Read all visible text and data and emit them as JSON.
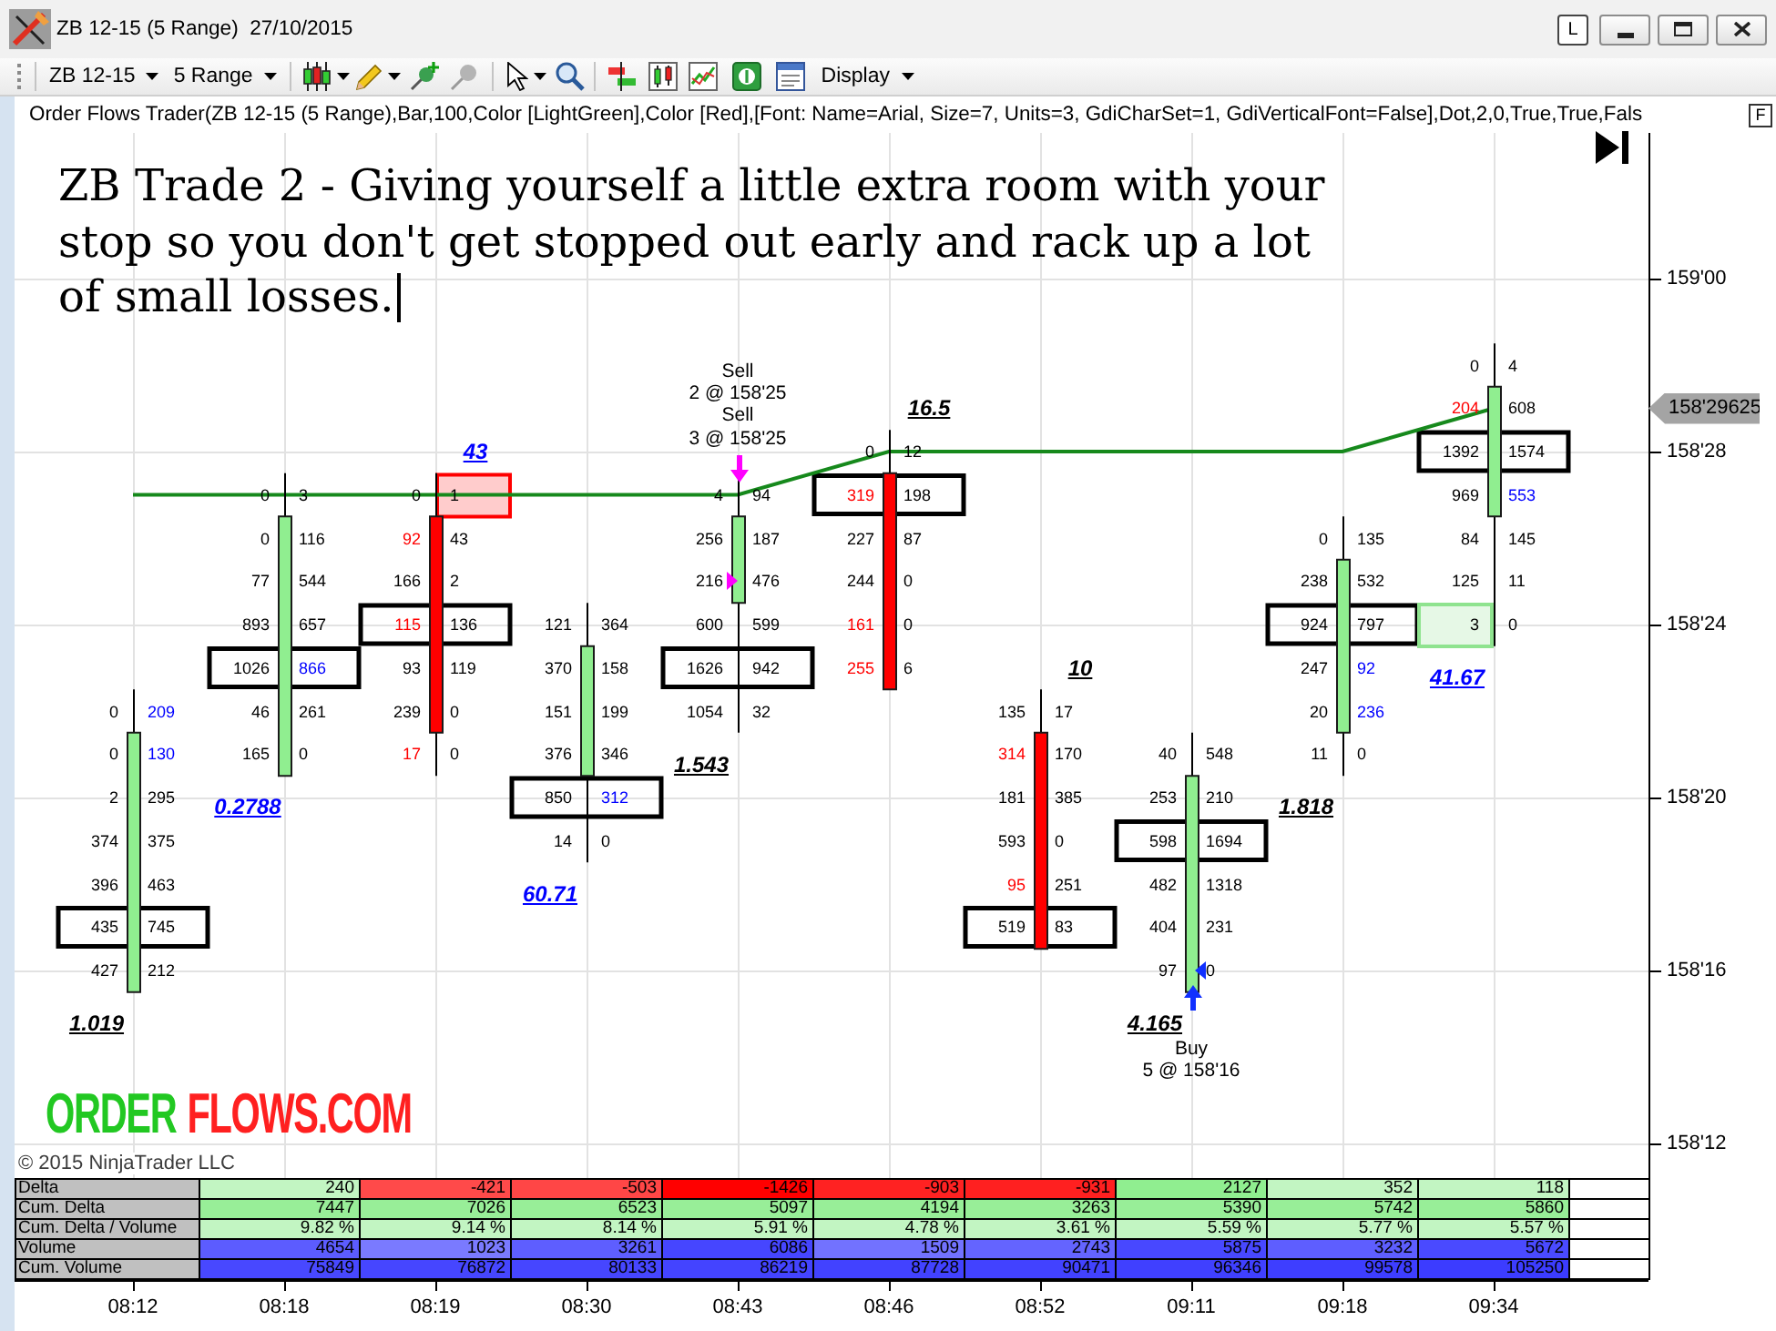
{
  "window": {
    "title": "ZB 12-15 (5 Range)  27/10/2015",
    "caption_button": "L"
  },
  "toolbar": {
    "instrument": "ZB 12-15",
    "period": "5 Range",
    "display": "Display"
  },
  "chart": {
    "indicator_label": "Order Flows Trader(ZB 12-15 (5 Range),Bar,100,Color [LightGreen],Color [Red],[Font: Name=Arial, Size=7, Units=3, GdiCharSet=1, GdiVerticalFont=False],Dot,2,0,True,True,Fals",
    "panel_button": "F",
    "annotation": "ZB Trade 2 - Giving yourself a little extra room with your stop so you don't get stopped out early and rack up a lot of small losses.",
    "logo": [
      {
        "text": "ORDER",
        "color": "#22c822"
      },
      {
        "text": "FLOWS.COM",
        "color": "#ff2020"
      }
    ],
    "price_axis": [
      "159'00",
      "158'28",
      "158'24",
      "158'20",
      "158'16",
      "158'12"
    ],
    "last_price": "158'29625",
    "time_axis": [
      "08:12",
      "08:18",
      "08:19",
      "08:30",
      "08:43",
      "08:46",
      "08:52",
      "09:11",
      "09:18",
      "09:34"
    ],
    "bars": [
      {
        "kind": "up",
        "ratio": {
          "text": "1.019",
          "color": "#000000"
        },
        "rows": [
          null,
          null,
          null,
          null,
          null,
          null,
          null,
          null,
          null,
          null,
          {
            "bid": "0",
            "ask": "209",
            "bid_imbalance": false,
            "ask_imbalance": true,
            "boxed": false,
            "bid_highlighted": false,
            "ask_highlighted": false,
            "body": false,
            "fill": false
          },
          {
            "bid": "0",
            "ask": "130",
            "bid_imbalance": false,
            "ask_imbalance": true,
            "boxed": false,
            "bid_highlighted": false,
            "ask_highlighted": false,
            "body": true,
            "fill": false
          },
          {
            "bid": "2",
            "ask": "295",
            "bid_imbalance": false,
            "ask_imbalance": false,
            "boxed": false,
            "bid_highlighted": false,
            "ask_highlighted": false,
            "body": true,
            "fill": false
          },
          {
            "bid": "374",
            "ask": "375",
            "bid_imbalance": false,
            "ask_imbalance": false,
            "boxed": false,
            "bid_highlighted": false,
            "ask_highlighted": false,
            "body": true,
            "fill": false
          },
          {
            "bid": "396",
            "ask": "463",
            "bid_imbalance": false,
            "ask_imbalance": false,
            "boxed": false,
            "bid_highlighted": false,
            "ask_highlighted": false,
            "body": true,
            "fill": false
          },
          {
            "bid": "435",
            "ask": "745",
            "bid_imbalance": false,
            "ask_imbalance": false,
            "boxed": true,
            "bid_highlighted": false,
            "ask_highlighted": false,
            "body": true,
            "fill": false
          },
          {
            "bid": "427",
            "ask": "212",
            "bid_imbalance": false,
            "ask_imbalance": false,
            "boxed": false,
            "bid_highlighted": false,
            "ask_highlighted": false,
            "body": true,
            "fill": false
          }
        ]
      },
      {
        "kind": "up",
        "ratio": {
          "text": "0.2788",
          "color": "#0000ff"
        },
        "rows": [
          null,
          null,
          null,
          null,
          null,
          {
            "bid": "0",
            "ask": "3",
            "bid_imbalance": false,
            "ask_imbalance": false,
            "boxed": false,
            "bid_highlighted": false,
            "ask_highlighted": false,
            "body": false,
            "fill": false
          },
          {
            "bid": "0",
            "ask": "116",
            "bid_imbalance": false,
            "ask_imbalance": false,
            "boxed": false,
            "bid_highlighted": false,
            "ask_highlighted": false,
            "body": true,
            "fill": false
          },
          {
            "bid": "77",
            "ask": "544",
            "bid_imbalance": false,
            "ask_imbalance": false,
            "boxed": false,
            "bid_highlighted": false,
            "ask_highlighted": false,
            "body": true,
            "fill": false
          },
          {
            "bid": "893",
            "ask": "657",
            "bid_imbalance": false,
            "ask_imbalance": false,
            "boxed": false,
            "bid_highlighted": false,
            "ask_highlighted": false,
            "body": true,
            "fill": false
          },
          {
            "bid": "1026",
            "ask": "866",
            "bid_imbalance": false,
            "ask_imbalance": true,
            "boxed": true,
            "bid_highlighted": false,
            "ask_highlighted": false,
            "body": true,
            "fill": false
          },
          {
            "bid": "46",
            "ask": "261",
            "bid_imbalance": false,
            "ask_imbalance": false,
            "boxed": false,
            "bid_highlighted": false,
            "ask_highlighted": false,
            "body": true,
            "fill": false
          },
          {
            "bid": "165",
            "ask": "0",
            "bid_imbalance": false,
            "ask_imbalance": false,
            "boxed": false,
            "bid_highlighted": false,
            "ask_highlighted": false,
            "body": true,
            "fill": false
          }
        ]
      },
      {
        "kind": "down",
        "ratio": {
          "text": "43",
          "color": "#0000ff"
        },
        "rows": [
          null,
          null,
          null,
          null,
          null,
          {
            "bid": "0",
            "ask": "1",
            "bid_imbalance": false,
            "ask_imbalance": false,
            "boxed": false,
            "bid_highlighted": false,
            "ask_highlighted": true,
            "body": false,
            "fill": false
          },
          {
            "bid": "92",
            "ask": "43",
            "bid_imbalance": true,
            "ask_imbalance": false,
            "boxed": false,
            "bid_highlighted": false,
            "ask_highlighted": false,
            "body": true,
            "fill": false
          },
          {
            "bid": "166",
            "ask": "2",
            "bid_imbalance": false,
            "ask_imbalance": false,
            "boxed": false,
            "bid_highlighted": false,
            "ask_highlighted": false,
            "body": true,
            "fill": false
          },
          {
            "bid": "115",
            "ask": "136",
            "bid_imbalance": true,
            "ask_imbalance": false,
            "boxed": true,
            "bid_highlighted": false,
            "ask_highlighted": false,
            "body": true,
            "fill": false
          },
          {
            "bid": "93",
            "ask": "119",
            "bid_imbalance": false,
            "ask_imbalance": false,
            "boxed": false,
            "bid_highlighted": false,
            "ask_highlighted": false,
            "body": true,
            "fill": false
          },
          {
            "bid": "239",
            "ask": "0",
            "bid_imbalance": false,
            "ask_imbalance": false,
            "boxed": false,
            "bid_highlighted": false,
            "ask_highlighted": false,
            "body": true,
            "fill": false
          },
          {
            "bid": "17",
            "ask": "0",
            "bid_imbalance": true,
            "ask_imbalance": false,
            "boxed": false,
            "bid_highlighted": false,
            "ask_highlighted": false,
            "body": false,
            "fill": false
          }
        ]
      },
      {
        "kind": "up",
        "ratio": {
          "text": "60.71",
          "color": "#0000ff"
        },
        "rows": [
          null,
          null,
          null,
          null,
          null,
          null,
          null,
          null,
          {
            "bid": "121",
            "ask": "364",
            "bid_imbalance": false,
            "ask_imbalance": false,
            "boxed": false,
            "bid_highlighted": false,
            "ask_highlighted": false,
            "body": false,
            "fill": false
          },
          {
            "bid": "370",
            "ask": "158",
            "bid_imbalance": false,
            "ask_imbalance": false,
            "boxed": false,
            "bid_highlighted": false,
            "ask_highlighted": false,
            "body": true,
            "fill": false
          },
          {
            "bid": "151",
            "ask": "199",
            "bid_imbalance": false,
            "ask_imbalance": false,
            "boxed": false,
            "bid_highlighted": false,
            "ask_highlighted": false,
            "body": true,
            "fill": false
          },
          {
            "bid": "376",
            "ask": "346",
            "bid_imbalance": false,
            "ask_imbalance": false,
            "boxed": false,
            "bid_highlighted": false,
            "ask_highlighted": false,
            "body": true,
            "fill": false
          },
          {
            "bid": "850",
            "ask": "312",
            "bid_imbalance": false,
            "ask_imbalance": true,
            "boxed": true,
            "bid_highlighted": false,
            "ask_highlighted": false,
            "body": false,
            "fill": false
          },
          {
            "bid": "14",
            "ask": "0",
            "bid_imbalance": false,
            "ask_imbalance": false,
            "boxed": false,
            "bid_highlighted": false,
            "ask_highlighted": false,
            "body": false,
            "fill": false
          }
        ]
      },
      {
        "kind": "up",
        "ratio": {
          "text": "1.543",
          "color": "#000000"
        },
        "order": {
          "kind": "sell",
          "lines": [
            "Sell",
            "2 @ 158'25",
            "Sell",
            "3 @ 158'25"
          ]
        },
        "rows": [
          null,
          null,
          null,
          null,
          null,
          {
            "bid": "4",
            "ask": "94",
            "bid_imbalance": false,
            "ask_imbalance": false,
            "boxed": false,
            "bid_highlighted": false,
            "ask_highlighted": false,
            "body": false,
            "fill": false
          },
          {
            "bid": "256",
            "ask": "187",
            "bid_imbalance": false,
            "ask_imbalance": false,
            "boxed": false,
            "bid_highlighted": false,
            "ask_highlighted": false,
            "body": true,
            "fill": false
          },
          {
            "bid": "216",
            "ask": "476",
            "bid_imbalance": false,
            "ask_imbalance": false,
            "boxed": false,
            "bid_highlighted": false,
            "ask_highlighted": false,
            "body": true,
            "fill": true
          },
          {
            "bid": "600",
            "ask": "599",
            "bid_imbalance": false,
            "ask_imbalance": false,
            "boxed": false,
            "bid_highlighted": false,
            "ask_highlighted": false,
            "body": false,
            "fill": false
          },
          {
            "bid": "1626",
            "ask": "942",
            "bid_imbalance": false,
            "ask_imbalance": false,
            "boxed": true,
            "bid_highlighted": false,
            "ask_highlighted": false,
            "body": false,
            "fill": false
          },
          {
            "bid": "1054",
            "ask": "32",
            "bid_imbalance": false,
            "ask_imbalance": false,
            "boxed": false,
            "bid_highlighted": false,
            "ask_highlighted": false,
            "body": false,
            "fill": false
          }
        ]
      },
      {
        "kind": "down",
        "ratio": {
          "text": "16.5",
          "color": "#000000"
        },
        "rows": [
          null,
          null,
          null,
          null,
          {
            "bid": "0",
            "ask": "12",
            "bid_imbalance": false,
            "ask_imbalance": false,
            "boxed": false,
            "bid_highlighted": false,
            "ask_highlighted": false,
            "body": false,
            "fill": false
          },
          {
            "bid": "319",
            "ask": "198",
            "bid_imbalance": true,
            "ask_imbalance": false,
            "boxed": true,
            "bid_highlighted": false,
            "ask_highlighted": false,
            "body": true,
            "fill": false
          },
          {
            "bid": "227",
            "ask": "87",
            "bid_imbalance": false,
            "ask_imbalance": false,
            "boxed": false,
            "bid_highlighted": false,
            "ask_highlighted": false,
            "body": true,
            "fill": false
          },
          {
            "bid": "244",
            "ask": "0",
            "bid_imbalance": false,
            "ask_imbalance": false,
            "boxed": false,
            "bid_highlighted": false,
            "ask_highlighted": false,
            "body": true,
            "fill": false
          },
          {
            "bid": "161",
            "ask": "0",
            "bid_imbalance": true,
            "ask_imbalance": false,
            "boxed": false,
            "bid_highlighted": false,
            "ask_highlighted": false,
            "body": true,
            "fill": false
          },
          {
            "bid": "255",
            "ask": "6",
            "bid_imbalance": true,
            "ask_imbalance": false,
            "boxed": false,
            "bid_highlighted": false,
            "ask_highlighted": false,
            "body": true,
            "fill": false
          }
        ]
      },
      {
        "kind": "down",
        "ratio": {
          "text": "10",
          "color": "#000000"
        },
        "rows": [
          null,
          null,
          null,
          null,
          null,
          null,
          null,
          null,
          null,
          null,
          {
            "bid": "135",
            "ask": "17",
            "bid_imbalance": false,
            "ask_imbalance": false,
            "boxed": false,
            "bid_highlighted": false,
            "ask_highlighted": false,
            "body": false,
            "fill": false
          },
          {
            "bid": "314",
            "ask": "170",
            "bid_imbalance": true,
            "ask_imbalance": false,
            "boxed": false,
            "bid_highlighted": false,
            "ask_highlighted": false,
            "body": true,
            "fill": false
          },
          {
            "bid": "181",
            "ask": "385",
            "bid_imbalance": false,
            "ask_imbalance": false,
            "boxed": false,
            "bid_highlighted": false,
            "ask_highlighted": false,
            "body": true,
            "fill": false
          },
          {
            "bid": "593",
            "ask": "0",
            "bid_imbalance": false,
            "ask_imbalance": false,
            "boxed": false,
            "bid_highlighted": false,
            "ask_highlighted": false,
            "body": true,
            "fill": false
          },
          {
            "bid": "95",
            "ask": "251",
            "bid_imbalance": true,
            "ask_imbalance": false,
            "boxed": false,
            "bid_highlighted": false,
            "ask_highlighted": false,
            "body": true,
            "fill": false
          },
          {
            "bid": "519",
            "ask": "83",
            "bid_imbalance": false,
            "ask_imbalance": false,
            "boxed": true,
            "bid_highlighted": false,
            "ask_highlighted": false,
            "body": true,
            "fill": false
          }
        ]
      },
      {
        "kind": "up",
        "ratio": {
          "text": "4.165",
          "color": "#000000"
        },
        "order": {
          "kind": "buy",
          "lines": [
            "Buy",
            "5 @ 158'16"
          ]
        },
        "rows": [
          null,
          null,
          null,
          null,
          null,
          null,
          null,
          null,
          null,
          null,
          null,
          {
            "bid": "40",
            "ask": "548",
            "bid_imbalance": false,
            "ask_imbalance": false,
            "boxed": false,
            "bid_highlighted": false,
            "ask_highlighted": false,
            "body": false,
            "fill": false
          },
          {
            "bid": "253",
            "ask": "210",
            "bid_imbalance": false,
            "ask_imbalance": false,
            "boxed": false,
            "bid_highlighted": false,
            "ask_highlighted": false,
            "body": true,
            "fill": false
          },
          {
            "bid": "598",
            "ask": "1694",
            "bid_imbalance": false,
            "ask_imbalance": false,
            "boxed": true,
            "bid_highlighted": false,
            "ask_highlighted": false,
            "body": true,
            "fill": false
          },
          {
            "bid": "482",
            "ask": "1318",
            "bid_imbalance": false,
            "ask_imbalance": false,
            "boxed": false,
            "bid_highlighted": false,
            "ask_highlighted": false,
            "body": true,
            "fill": false
          },
          {
            "bid": "404",
            "ask": "231",
            "bid_imbalance": false,
            "ask_imbalance": false,
            "boxed": false,
            "bid_highlighted": false,
            "ask_highlighted": false,
            "body": true,
            "fill": false
          },
          {
            "bid": "97",
            "ask": "0",
            "bid_imbalance": false,
            "ask_imbalance": false,
            "boxed": false,
            "bid_highlighted": false,
            "ask_highlighted": false,
            "body": true,
            "fill": true
          }
        ]
      },
      {
        "kind": "up",
        "ratio": {
          "text": "1.818",
          "color": "#000000"
        },
        "rows": [
          null,
          null,
          null,
          null,
          null,
          null,
          {
            "bid": "0",
            "ask": "135",
            "bid_imbalance": false,
            "ask_imbalance": false,
            "boxed": false,
            "bid_highlighted": false,
            "ask_highlighted": false,
            "body": false,
            "fill": false
          },
          {
            "bid": "238",
            "ask": "532",
            "bid_imbalance": false,
            "ask_imbalance": false,
            "boxed": false,
            "bid_highlighted": false,
            "ask_highlighted": false,
            "body": true,
            "fill": false
          },
          {
            "bid": "924",
            "ask": "797",
            "bid_imbalance": false,
            "ask_imbalance": false,
            "boxed": true,
            "bid_highlighted": false,
            "ask_highlighted": false,
            "body": true,
            "fill": false
          },
          {
            "bid": "247",
            "ask": "92",
            "bid_imbalance": false,
            "ask_imbalance": true,
            "boxed": false,
            "bid_highlighted": false,
            "ask_highlighted": false,
            "body": true,
            "fill": false
          },
          {
            "bid": "20",
            "ask": "236",
            "bid_imbalance": false,
            "ask_imbalance": true,
            "boxed": false,
            "bid_highlighted": false,
            "ask_highlighted": false,
            "body": true,
            "fill": false
          },
          {
            "bid": "11",
            "ask": "0",
            "bid_imbalance": false,
            "ask_imbalance": false,
            "boxed": false,
            "bid_highlighted": false,
            "ask_highlighted": false,
            "body": false,
            "fill": false
          }
        ]
      },
      {
        "kind": "up",
        "ratio": {
          "text": "41.67",
          "color": "#0000ff"
        },
        "rows": [
          null,
          null,
          {
            "bid": "0",
            "ask": "4",
            "bid_imbalance": false,
            "ask_imbalance": false,
            "boxed": false,
            "bid_highlighted": false,
            "ask_highlighted": false,
            "body": false,
            "fill": false
          },
          {
            "bid": "204",
            "ask": "608",
            "bid_imbalance": true,
            "ask_imbalance": false,
            "boxed": false,
            "bid_highlighted": false,
            "ask_highlighted": false,
            "body": true,
            "fill": false
          },
          {
            "bid": "1392",
            "ask": "1574",
            "bid_imbalance": false,
            "ask_imbalance": false,
            "boxed": true,
            "bid_highlighted": false,
            "ask_highlighted": false,
            "body": true,
            "fill": false
          },
          {
            "bid": "969",
            "ask": "553",
            "bid_imbalance": false,
            "ask_imbalance": true,
            "boxed": false,
            "bid_highlighted": false,
            "ask_highlighted": false,
            "body": true,
            "fill": false
          },
          {
            "bid": "84",
            "ask": "145",
            "bid_imbalance": false,
            "ask_imbalance": false,
            "boxed": false,
            "bid_highlighted": false,
            "ask_highlighted": false,
            "body": false,
            "fill": false
          },
          {
            "bid": "125",
            "ask": "11",
            "bid_imbalance": false,
            "ask_imbalance": false,
            "boxed": false,
            "bid_highlighted": false,
            "ask_highlighted": false,
            "body": false,
            "fill": false
          },
          {
            "bid": "3",
            "ask": "0",
            "bid_imbalance": false,
            "ask_imbalance": false,
            "boxed": false,
            "bid_highlighted": true,
            "ask_highlighted": false,
            "body": false,
            "fill": false
          }
        ]
      }
    ]
  },
  "stats_table": {
    "rows": [
      {
        "label": "Delta",
        "cells": [
          {
            "text": "240",
            "color": "#c2f5c2"
          },
          {
            "text": "-421",
            "color": "#ff4a4a"
          },
          {
            "text": "-503",
            "color": "#ff4646"
          },
          {
            "text": "-1426",
            "color": "#ff0000"
          },
          {
            "text": "-903",
            "color": "#ff2222"
          },
          {
            "text": "-931",
            "color": "#ff2020"
          },
          {
            "text": "2127",
            "color": "#90ee90"
          },
          {
            "text": "352",
            "color": "#c2f5c2"
          },
          {
            "text": "118",
            "color": "#c2f5c2"
          }
        ]
      },
      {
        "label": "Cum. Delta",
        "cells": [
          {
            "text": "7447",
            "color": "#98ee98"
          },
          {
            "text": "7026",
            "color": "#98ee98"
          },
          {
            "text": "6523",
            "color": "#98ee98"
          },
          {
            "text": "5097",
            "color": "#98ee98"
          },
          {
            "text": "4194",
            "color": "#98ee98"
          },
          {
            "text": "3263",
            "color": "#98ee98"
          },
          {
            "text": "5390",
            "color": "#98ee98"
          },
          {
            "text": "5742",
            "color": "#98ee98"
          },
          {
            "text": "5860",
            "color": "#98ee98"
          }
        ]
      },
      {
        "label": "Cum. Delta / Volume",
        "cells": [
          {
            "text": "9.82 %",
            "color": "#c2f5c2"
          },
          {
            "text": "9.14 %",
            "color": "#c2f5c2"
          },
          {
            "text": "8.14 %",
            "color": "#c2f5c2"
          },
          {
            "text": "5.91 %",
            "color": "#c2f5c2"
          },
          {
            "text": "4.78 %",
            "color": "#c2f5c2"
          },
          {
            "text": "3.61 %",
            "color": "#c2f5c2"
          },
          {
            "text": "5.59 %",
            "color": "#c2f5c2"
          },
          {
            "text": "5.77 %",
            "color": "#c2f5c2"
          },
          {
            "text": "5.57 %",
            "color": "#c2f5c2"
          }
        ]
      },
      {
        "label": "Volume",
        "cells": [
          {
            "text": "4654",
            "color": "#5c5cff"
          },
          {
            "text": "1023",
            "color": "#7a7aff"
          },
          {
            "text": "3261",
            "color": "#5e5eff"
          },
          {
            "text": "6086",
            "color": "#4646ff"
          },
          {
            "text": "1509",
            "color": "#7272ff"
          },
          {
            "text": "2743",
            "color": "#6464ff"
          },
          {
            "text": "5875",
            "color": "#4848ff"
          },
          {
            "text": "3232",
            "color": "#5e5eff"
          },
          {
            "text": "5672",
            "color": "#4a4aff"
          }
        ]
      },
      {
        "label": "Cum. Volume",
        "cells": [
          {
            "text": "75849",
            "color": "#4848ff"
          },
          {
            "text": "76872",
            "color": "#4646ff"
          },
          {
            "text": "80133",
            "color": "#4646ff"
          },
          {
            "text": "86219",
            "color": "#4444ff"
          },
          {
            "text": "87728",
            "color": "#4242ff"
          },
          {
            "text": "90471",
            "color": "#4242ff"
          },
          {
            "text": "96346",
            "color": "#4040ff"
          },
          {
            "text": "99578",
            "color": "#3e3eff"
          },
          {
            "text": "105250",
            "color": "#3c3cff"
          }
        ]
      }
    ]
  },
  "copyright": "© 2015 NinjaTrader LLC"
}
